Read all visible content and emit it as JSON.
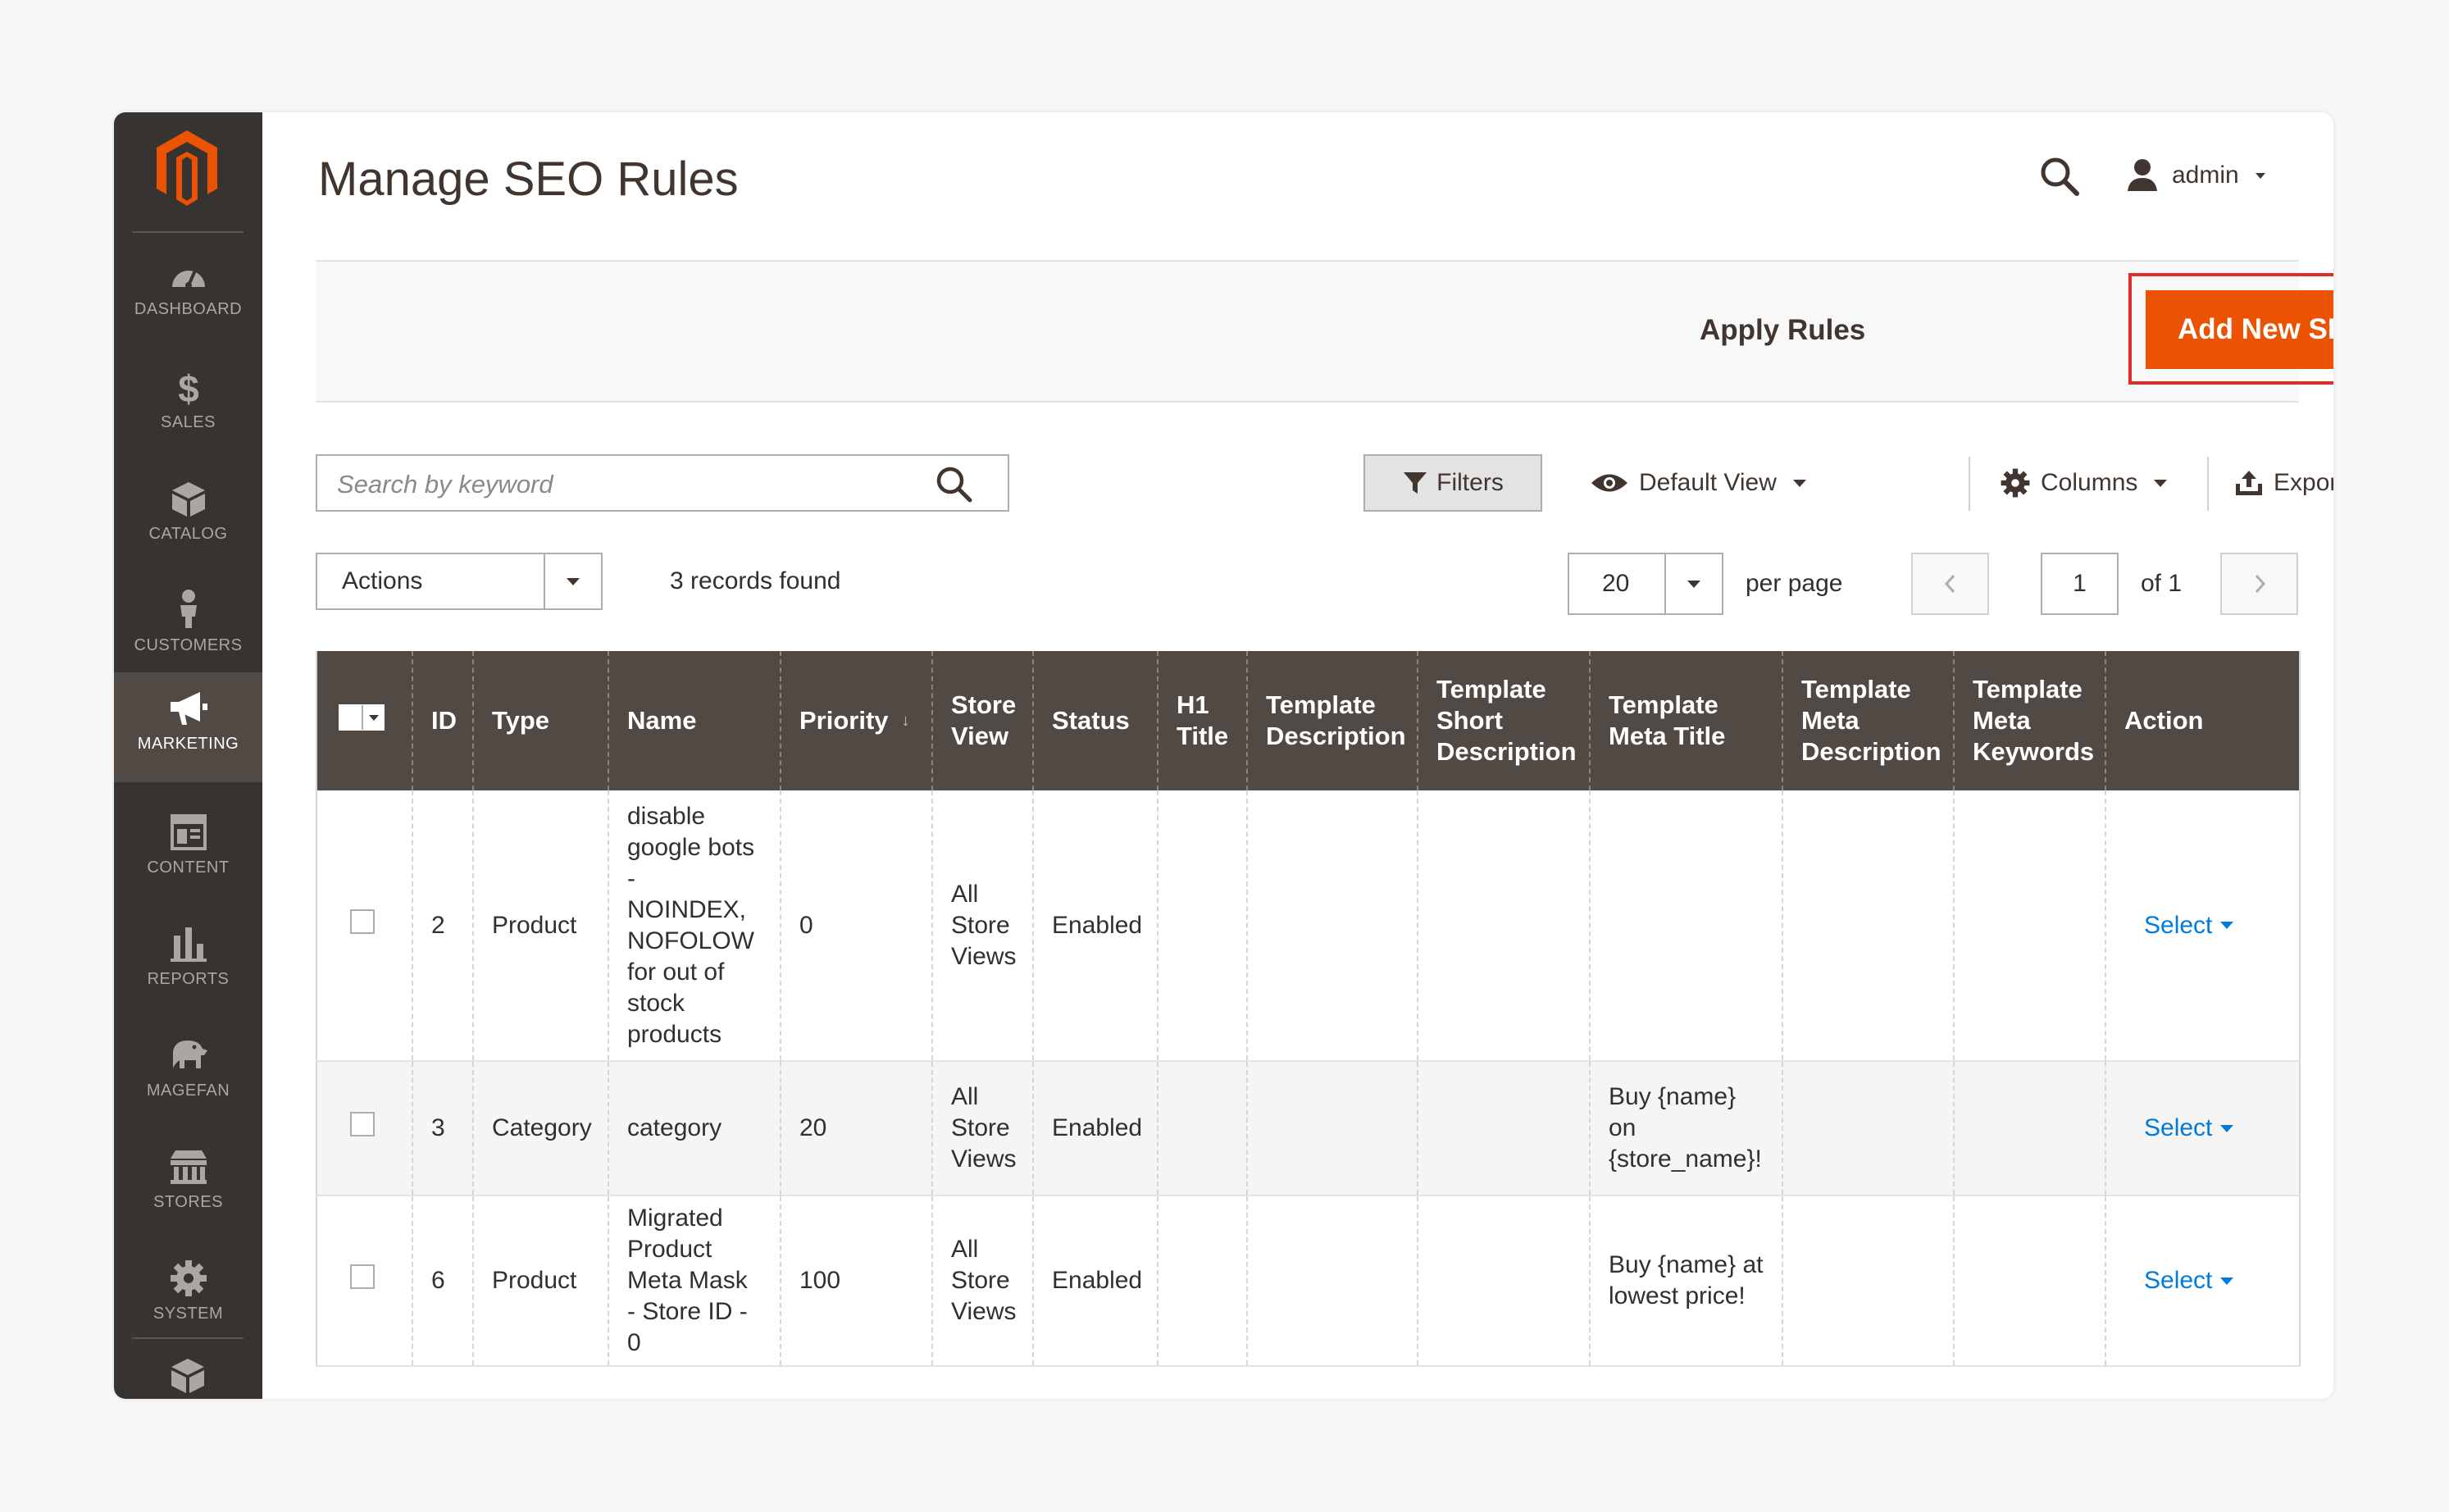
{
  "header": {
    "title": "Manage SEO Rules",
    "user": "admin"
  },
  "sidebar": {
    "items": [
      {
        "label": "DASHBOARD",
        "icon": "dashboard-icon"
      },
      {
        "label": "SALES",
        "icon": "dollar-icon"
      },
      {
        "label": "CATALOG",
        "icon": "catalog-box-icon"
      },
      {
        "label": "CUSTOMERS",
        "icon": "person-icon"
      },
      {
        "label": "MARKETING",
        "icon": "megaphone-icon",
        "active": true
      },
      {
        "label": "CONTENT",
        "icon": "content-layout-icon"
      },
      {
        "label": "REPORTS",
        "icon": "bar-chart-icon"
      },
      {
        "label": "MAGEFAN",
        "icon": "magefan-elephant-icon"
      },
      {
        "label": "STORES",
        "icon": "store-icon"
      },
      {
        "label": "SYSTEM",
        "icon": "gear-icon"
      }
    ]
  },
  "action_bar": {
    "apply_label": "Apply Rules",
    "add_label": "Add New SEO Rule"
  },
  "toolbar": {
    "search_placeholder": "Search by keyword",
    "filters_label": "Filters",
    "view_label": "Default View",
    "columns_label": "Columns",
    "export_label": "Export",
    "actions_label": "Actions",
    "records_found": "3 records found",
    "per_page_value": "20",
    "per_page_label": "per page",
    "page_current": "1",
    "page_total": "of 1"
  },
  "table": {
    "columns": {
      "id": "ID",
      "type": "Type",
      "name": "Name",
      "priority": "Priority",
      "store_view": "Store View",
      "status": "Status",
      "h1_title": "H1 Title",
      "template_description": "Template Description",
      "template_short_description": "Template Short Description",
      "template_meta_title": "Template Meta Title",
      "template_meta_description": "Template Meta Description",
      "template_meta_keywords": "Template Meta Keywords",
      "action": "Action"
    },
    "rows": [
      {
        "id": "2",
        "type": "Product",
        "name": "disable google bots - NOINDEX, NOFOLOW for out of stock products",
        "priority": "0",
        "store_view": "All Store Views",
        "status": "Enabled",
        "meta_title": "",
        "action": "Select"
      },
      {
        "id": "3",
        "type": "Category",
        "name": "category",
        "priority": "20",
        "store_view": "All Store Views",
        "status": "Enabled",
        "meta_title": "Buy {name} on {store_name}!",
        "action": "Select"
      },
      {
        "id": "6",
        "type": "Product",
        "name": "Migrated Product Meta Mask - Store ID - 0",
        "priority": "100",
        "store_view": "All Store Views",
        "status": "Enabled",
        "meta_title": "Buy {name} at lowest price!",
        "action": "Select"
      }
    ]
  },
  "colors": {
    "sidebar_bg": "#373330",
    "sidebar_active": "#514943",
    "accent": "#eb5202",
    "highlight": "#e02b27",
    "link": "#007bdb"
  }
}
